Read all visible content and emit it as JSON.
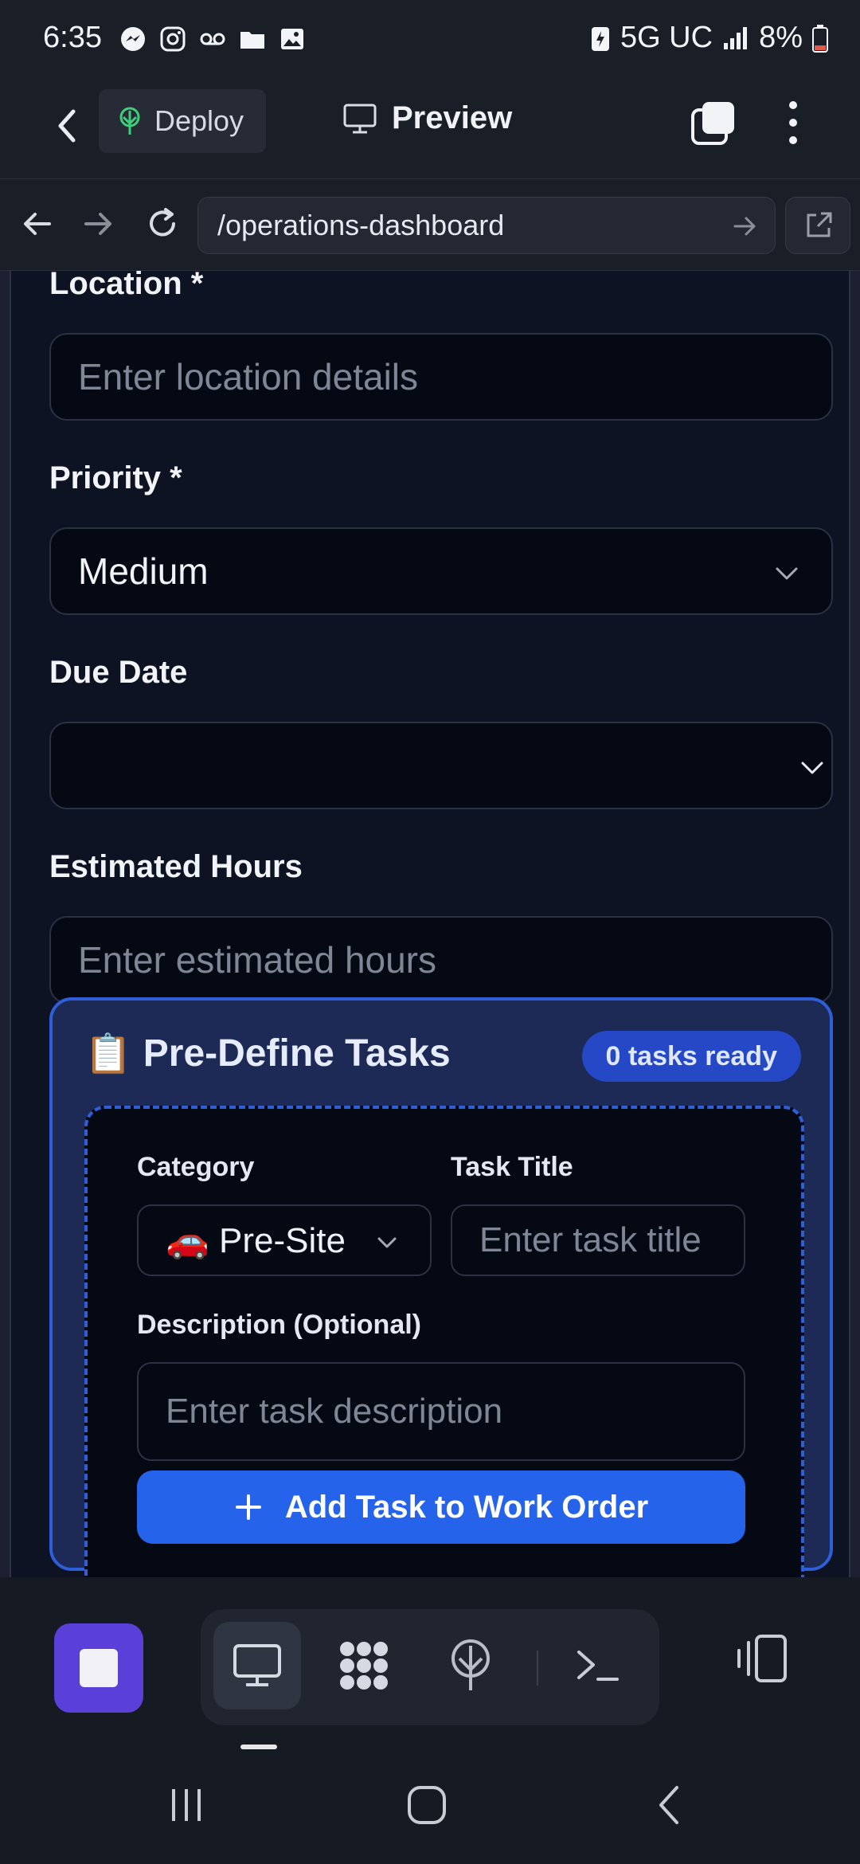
{
  "status_bar": {
    "time": "6:35",
    "network": "5G UC",
    "battery": "8%",
    "icons": [
      "messenger-icon",
      "instagram-icon",
      "voicemail-icon",
      "folder-icon",
      "gallery-icon",
      "battery-saver-icon",
      "signal-icon",
      "battery-icon"
    ]
  },
  "app_bar": {
    "deploy_label": "Deploy",
    "preview_label": "Preview"
  },
  "browser": {
    "url": "/operations-dashboard"
  },
  "form": {
    "location": {
      "label": "Location *",
      "placeholder": "Enter location details"
    },
    "priority": {
      "label": "Priority *",
      "value": "Medium"
    },
    "due_date": {
      "label": "Due Date",
      "value": ""
    },
    "estimated_hours": {
      "label": "Estimated Hours",
      "placeholder": "Enter estimated hours"
    }
  },
  "predefine": {
    "emoji": "📋",
    "title": "Pre-Define Tasks",
    "badge": "0 tasks ready",
    "category_label": "Category",
    "category_value": "🚗 Pre-Site",
    "task_title_label": "Task Title",
    "task_title_placeholder": "Enter task title",
    "description_label": "Description (Optional)",
    "description_placeholder": "Enter task description",
    "add_button": "Add Task to Work Order"
  },
  "colors": {
    "accent": "#2563eb",
    "stop_button": "#5b3fd9",
    "panel_border": "#2f5fd8"
  }
}
